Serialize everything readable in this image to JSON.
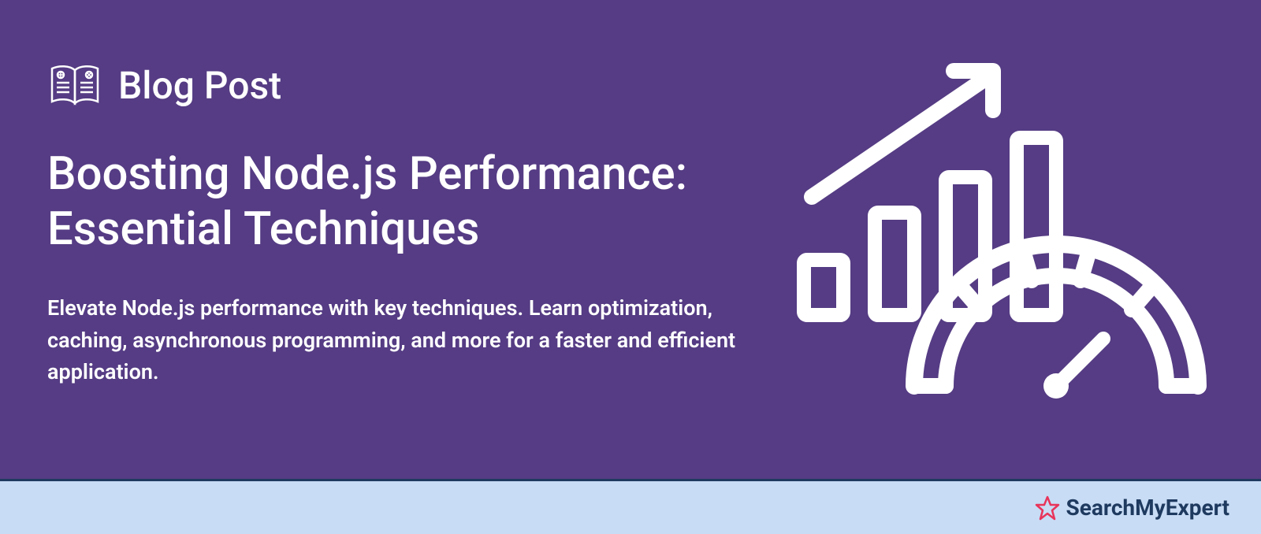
{
  "category": {
    "label": "Blog Post"
  },
  "title": "Boosting Node.js Performance: Essential Techniques",
  "description": "Elevate Node.js performance with key techniques. Learn optimization, caching, asynchronous programming, and more for a faster and efficient application.",
  "footer": {
    "brand": "SearchMyExpert"
  },
  "colors": {
    "background": "#553C84",
    "text": "#ffffff",
    "footer_bg": "#C8DCF5",
    "brand_text": "#1F3A5F",
    "star_accent": "#E8345A"
  }
}
